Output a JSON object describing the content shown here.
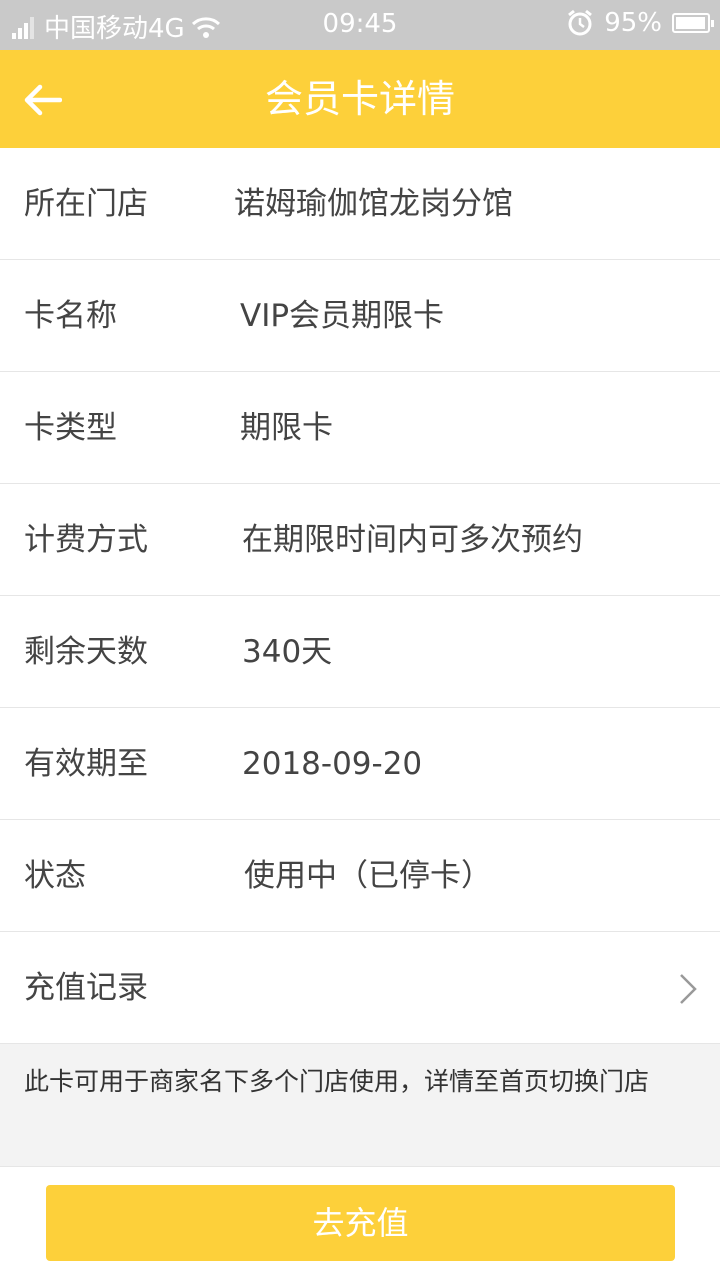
{
  "status_bar": {
    "carrier": "中国移动4G",
    "time": "09:45",
    "battery": "95%",
    "battery_level": 0.95
  },
  "header": {
    "title": "会员卡详情",
    "back_icon": "arrow-left-icon"
  },
  "rows": [
    {
      "label": "所在门店",
      "value": "诺姆瑜伽馆龙岗分馆"
    },
    {
      "label": "卡名称",
      "value": "VIP会员期限卡"
    },
    {
      "label": "卡类型",
      "value": "期限卡"
    },
    {
      "label": "计费方式",
      "value": "在期限时间内可多次预约"
    },
    {
      "label": "剩余天数",
      "value": "340天"
    },
    {
      "label": "有效期至",
      "value": "2018-09-20"
    },
    {
      "label": "状态",
      "value": "使用中（已停卡）"
    }
  ],
  "recharge_record": {
    "label": "充值记录",
    "icon": "chevron-right-icon"
  },
  "note": "此卡可用于商家名下多个门店使用，详情至首页切换门店",
  "footer": {
    "button_label": "去充值"
  },
  "colors": {
    "accent": "#fdd03a",
    "status_bar": "#c9c9c9",
    "background": "#f3f3f3"
  }
}
